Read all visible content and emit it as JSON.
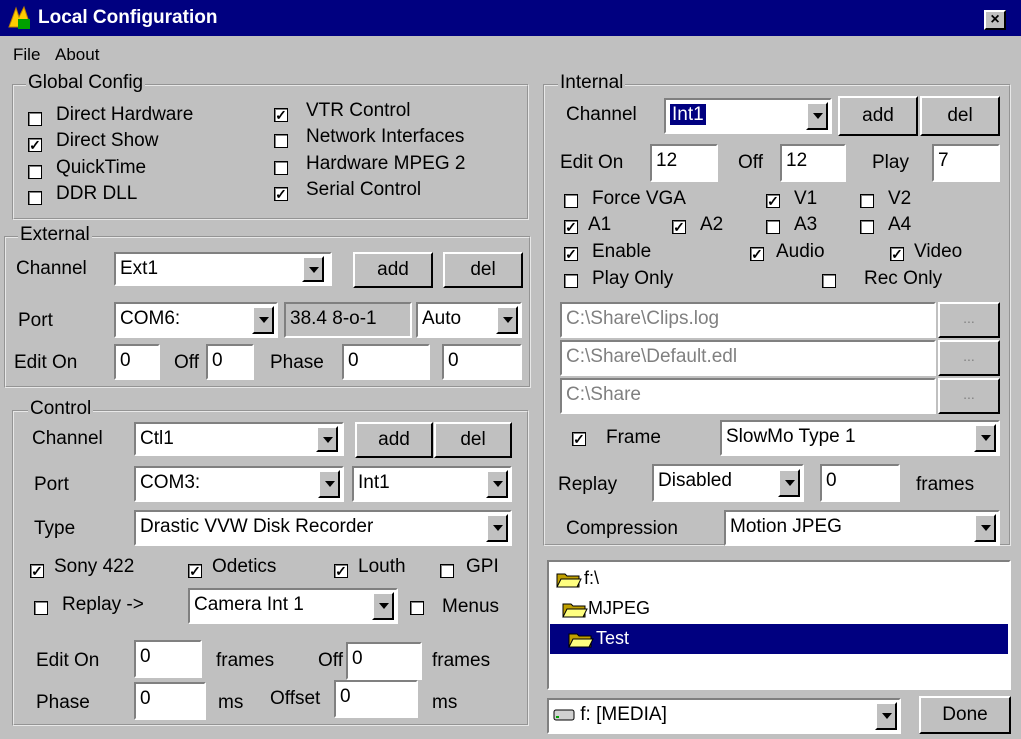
{
  "window": {
    "title": "Local Configuration",
    "close_label": "×"
  },
  "menu": {
    "items": [
      "File",
      "About"
    ]
  },
  "global_config": {
    "legend": "Global Config",
    "options": [
      {
        "label": "Direct Hardware",
        "checked": false
      },
      {
        "label": "Direct Show",
        "checked": true
      },
      {
        "label": "QuickTime",
        "checked": false
      },
      {
        "label": "DDR DLL",
        "checked": false
      },
      {
        "label": "VTR Control",
        "checked": true
      },
      {
        "label": "Network Interfaces",
        "checked": false
      },
      {
        "label": "Hardware MPEG 2",
        "checked": false
      },
      {
        "label": "Serial Control",
        "checked": true
      }
    ]
  },
  "external": {
    "legend": "External",
    "channel_label": "Channel",
    "channel_value": "Ext1",
    "add_label": "add",
    "del_label": "del",
    "port_label": "Port",
    "port_value": "COM6:",
    "baud_value": "38.4 8-o-1",
    "mode_value": "Auto",
    "edit_on_label": "Edit On",
    "edit_on_value": "0",
    "off_label": "Off",
    "off_value": "0",
    "phase_label": "Phase",
    "phase_value": "0",
    "phase_value2": "0"
  },
  "control": {
    "legend": "Control",
    "channel_label": "Channel",
    "channel_value": "Ctl1",
    "add_label": "add",
    "del_label": "del",
    "port_label": "Port",
    "port_value": "COM3:",
    "port_target": "Int1",
    "type_label": "Type",
    "type_value": "Drastic VVW Disk Recorder",
    "protocols": [
      {
        "label": "Sony 422",
        "checked": true
      },
      {
        "label": "Odetics",
        "checked": true
      },
      {
        "label": "Louth",
        "checked": true
      },
      {
        "label": "GPI",
        "checked": false
      }
    ],
    "replay_label": "Replay ->",
    "replay_checked": false,
    "replay_value": "Camera Int 1",
    "menus_label": "Menus",
    "menus_checked": false,
    "edit_on_label": "Edit On",
    "edit_on_value": "0",
    "frames_label": "frames",
    "off_label": "Off",
    "off_value": "0",
    "frames_label2": "frames",
    "phase_label": "Phase",
    "phase_value": "0",
    "ms_label": "ms",
    "offset_label": "Offset",
    "offset_value": "0",
    "ms_label2": "ms"
  },
  "internal": {
    "legend": "Internal",
    "channel_label": "Channel",
    "channel_value": "Int1",
    "add_label": "add",
    "del_label": "del",
    "edit_on_label": "Edit On",
    "edit_on_value": "12",
    "off_label": "Off",
    "off_value": "12",
    "play_label": "Play",
    "play_value": "7",
    "force_vga": {
      "label": "Force VGA",
      "checked": false
    },
    "v1": {
      "label": "V1",
      "checked": true
    },
    "v2": {
      "label": "V2",
      "checked": false
    },
    "a1": {
      "label": "A1",
      "checked": true
    },
    "a2": {
      "label": "A2",
      "checked": true
    },
    "a3": {
      "label": "A3",
      "checked": false
    },
    "a4": {
      "label": "A4",
      "checked": false
    },
    "enable": {
      "label": "Enable",
      "checked": true
    },
    "audio": {
      "label": "Audio",
      "checked": true
    },
    "video": {
      "label": "Video",
      "checked": true
    },
    "play_only": {
      "label": "Play Only",
      "checked": false
    },
    "rec_only": {
      "label": "Rec Only",
      "checked": false
    },
    "clips_path": "C:\\Share\\Clips.log",
    "edl_path": "C:\\Share\\Default.edl",
    "share_path": "C:\\Share",
    "browse_label": "...",
    "frame": {
      "label": "Frame",
      "checked": true
    },
    "slowmo_value": "SlowMo Type 1",
    "replay_label": "Replay",
    "replay_value": "Disabled",
    "replay_frames_value": "0",
    "frames_label": "frames",
    "compression_label": "Compression",
    "compression_value": "Motion JPEG"
  },
  "browser": {
    "folders": [
      "f:\\",
      "MJPEG",
      "Test"
    ],
    "drive_value": "f: [MEDIA]",
    "done_label": "Done"
  }
}
